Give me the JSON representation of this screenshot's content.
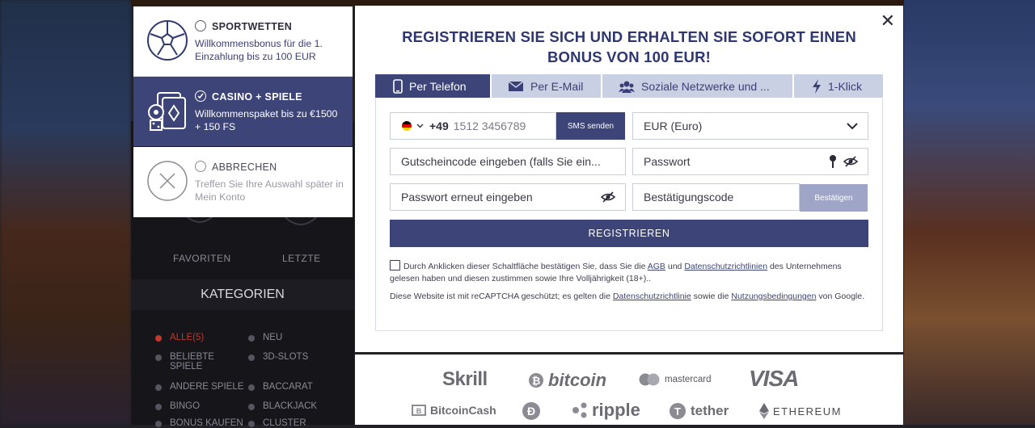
{
  "background": {
    "sidebar": {
      "fav_labels": [
        "FAVORITEN",
        "LETZTE"
      ],
      "kategorien_title": "KATEGORIEN",
      "categories": [
        "ALLE(5)",
        "NEU",
        "BELIEBTE SPIELE",
        "3D-SLOTS",
        "ANDERE SPIELE",
        "BACCARAT",
        "BINGO",
        "BLACKJACK",
        "BONUS KAUFEN",
        "CLUSTER"
      ]
    }
  },
  "bonus_options": [
    {
      "title": "SPORTWETTEN",
      "desc": "Willkommensbonus für die 1. Einzahlung bis zu 100 EUR",
      "icon": "soccer-ball-icon",
      "selected": false
    },
    {
      "title": "CASINO + SPIELE",
      "desc": "Willkommenspaket bis zu €1500 + 150 FS",
      "icon": "casino-cards-dice-icon",
      "selected": true
    },
    {
      "title": "ABBRECHEN",
      "desc": "Treffen Sie Ihre Auswahl später in Mein Konto",
      "icon": "cancel-circle-icon",
      "selected": false
    }
  ],
  "modal": {
    "close_label": "✕",
    "headline_line1": "REGISTRIEREN SIE SICH UND ERHALTEN SIE SOFORT EINEN",
    "headline_line2": "BONUS VON 100 EUR!",
    "tabs": [
      {
        "label": "Per Telefon",
        "icon": "phone-icon",
        "active": true
      },
      {
        "label": "Per E-Mail",
        "icon": "envelope-icon",
        "active": false
      },
      {
        "label": "Soziale Netzwerke und ...",
        "icon": "users-icon",
        "active": false
      },
      {
        "label": "1-Klick",
        "icon": "lightning-icon",
        "active": false
      }
    ],
    "form": {
      "phone_prefix": "+49",
      "phone_placeholder": "1512 3456789",
      "sms_button": "SMS senden",
      "currency": "EUR (Euro)",
      "promo_placeholder": "Gutscheincode eingeben (falls Sie ein...",
      "password_placeholder": "Passwort",
      "password_repeat_placeholder": "Passwort erneut eingeben",
      "confirmation_placeholder": "Bestätigungscode",
      "confirm_button": "Bestätigen",
      "register_button": "REGISTRIEREN"
    },
    "terms": {
      "part1": "Durch Anklicken dieser Schaltfläche bestätigen Sie, dass Sie die",
      "agb": "AGB",
      "und": "und",
      "privacy": "Datenschutzrichtlinien",
      "part2": "des Unternehmens gelesen haben und diesen zustimmen sowie Ihre Volljährigkeit (18+).."
    },
    "recaptcha": {
      "part1": "Diese Website ist mit reCAPTCHA geschützt; es gelten die",
      "privacy": "Datenschutzrichtlinie",
      "sowie": "sowie die",
      "terms": "Nutzungsbedingungen",
      "part2": "von Google."
    }
  },
  "payments": [
    "Skrill",
    "bitcoin",
    "mastercard",
    "VISA",
    "BitcoinCash",
    "ripple",
    "tether",
    "ETHEREUM"
  ]
}
